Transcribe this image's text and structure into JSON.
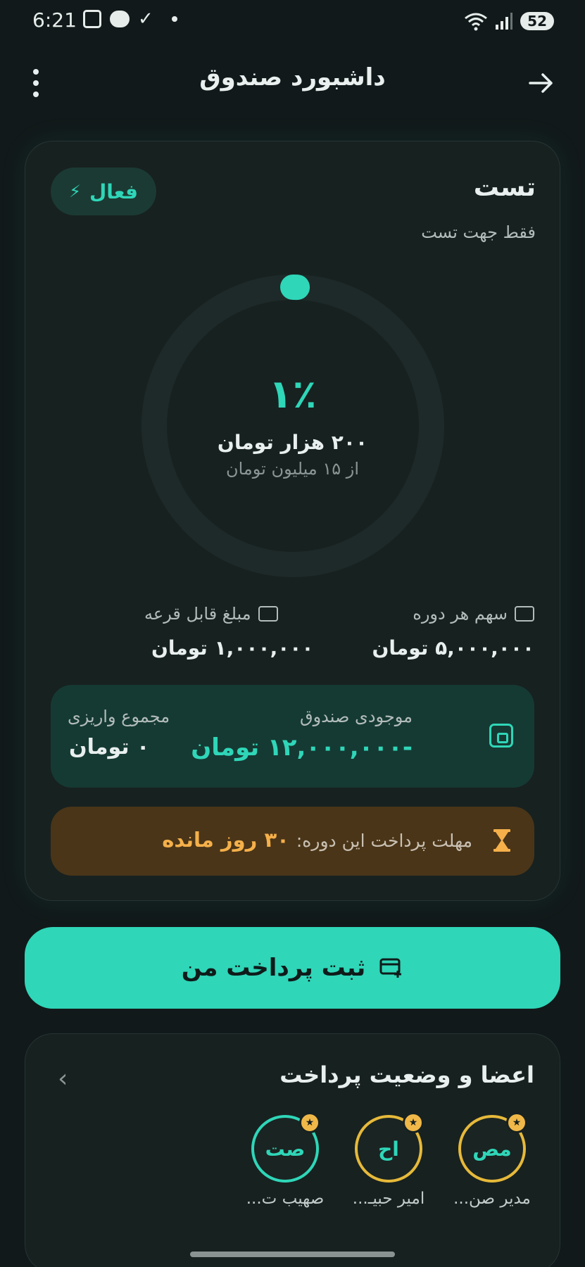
{
  "status_bar": {
    "time": "6:21",
    "battery": "52",
    "icons_left": [
      "screenshot-icon",
      "chat-icon",
      "check-icon",
      "dot-icon"
    ],
    "icons_right": [
      "wifi-icon",
      "signal-icon",
      "battery-icon"
    ]
  },
  "header": {
    "title": "داشبورد صندوق",
    "menu_icon": "more-vertical-icon",
    "back_icon": "arrow-right-icon"
  },
  "fund": {
    "name": "تست",
    "description": "فقط جهت تست",
    "status_label": "فعال",
    "status_icon": "bolt-icon"
  },
  "progress": {
    "percent_label": "۱٪",
    "percent_value": 1,
    "amount": "۲۰۰ هزار تومان",
    "of_total": "از ۱۵ میلیون تومان"
  },
  "stats": {
    "share_label": "سهم هر دوره",
    "share_value": "۵,۰۰۰,۰۰۰ تومان",
    "prize_label": "مبلغ قابل قرعه",
    "prize_value": "۱,۰۰۰,۰۰۰ تومان"
  },
  "balance": {
    "fund_balance_label": "موجودی صندوق",
    "fund_balance_value": "-۱۲,۰۰۰,۰۰۰ تومان",
    "total_deposit_label": "مجموع واریزی",
    "total_deposit_value": "۰ تومان"
  },
  "deadline": {
    "label": "مهلت پرداخت این دوره:",
    "value": "۳۰ روز مانده"
  },
  "pay_button": {
    "label": "ثبت پرداخت من"
  },
  "members": {
    "title": "اعضا و وضعیت پرداخت",
    "items": [
      {
        "initials": "مص",
        "name": "مدیر صن...",
        "ring": "gold"
      },
      {
        "initials": "اح",
        "name": "امیر حبیـ...",
        "ring": "gold"
      },
      {
        "initials": "صت",
        "name": "صهیب ت...",
        "ring": "teal"
      }
    ]
  },
  "colors": {
    "background": "#12191a",
    "card": "#172120",
    "accent": "#2fd6b8",
    "warning": "#f5b04a",
    "gold": "#e6b93a"
  }
}
